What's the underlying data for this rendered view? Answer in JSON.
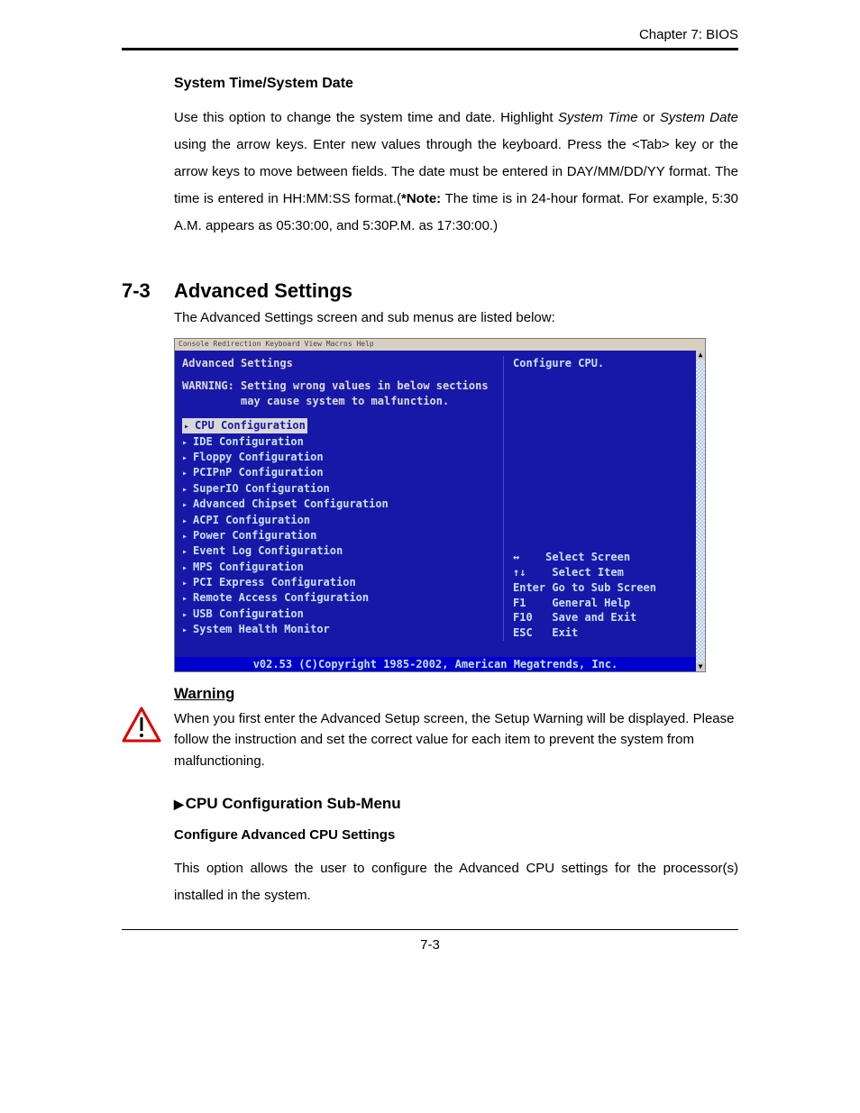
{
  "chapter_header": "Chapter 7: BIOS",
  "sys_time": {
    "heading": "System Time/System Date",
    "p1a": "Use this option to change the system time and date. Highlight ",
    "italic1": "System Time",
    "p1b": " or ",
    "italic2": "System Date",
    "p1c": " using the arrow keys. Enter new values through the keyboard. Press the <Tab> key or the arrow keys to move between fields. The date must be entered in DAY/MM/DD/YY format. The time is entered in HH:MM:SS format.(",
    "note_label": "*Note:",
    "p1d": " The time is in 24-hour format. For example, 5:30 A.M. appears as 05:30:00, and 5:30P.M. as 17:30:00.)"
  },
  "section": {
    "num": "7-3",
    "title": "Advanced Settings",
    "intro": "The Advanced Settings screen and sub menus are listed below:"
  },
  "bios": {
    "titlebar": "Console Redirection  Keyboard  View  Macros  Help",
    "screen_title": "Advanced Settings",
    "warning_label": "WARNING:",
    "warning_line1": "Setting wrong values in below sections",
    "warning_line2": "may cause system to malfunction.",
    "menu": [
      "CPU Configuration",
      "IDE Configuration",
      "Floppy Configuration",
      "PCIPnP Configuration",
      "SuperIO Configuration",
      "Advanced Chipset Configuration",
      "ACPI Configuration",
      "Power Configuration",
      "Event Log Configuration",
      "MPS Configuration",
      "PCI Express Configuration",
      "Remote Access Configuration",
      "USB Configuration",
      "System Health Monitor"
    ],
    "help_top": "Configure CPU.",
    "keys": {
      "k1": "↔    Select Screen",
      "k2": "↑↓    Select Item",
      "k3": "Enter Go to Sub Screen",
      "k4": "F1    General Help",
      "k5": "F10   Save and Exit",
      "k6": "ESC   Exit"
    },
    "footer": "v02.53 (C)Copyright 1985-2002, American Megatrends, Inc."
  },
  "warning": {
    "title": "Warning",
    "body": "When you first enter the Advanced Setup screen, the Setup Warning will be displayed. Please follow the instruction and set the correct value for each item to prevent the system from malfunctioning."
  },
  "cpu": {
    "heading": "CPU Configuration Sub-Menu",
    "sub": "Configure Advanced CPU Settings",
    "body": "This option allows the user to configure the Advanced CPU settings for the processor(s) installed in the system."
  },
  "page_num": "7-3"
}
